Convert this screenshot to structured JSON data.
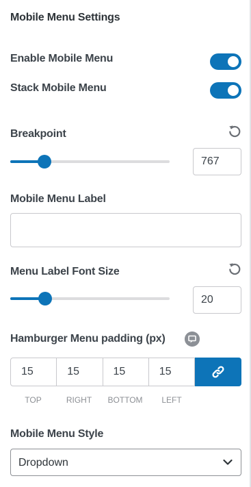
{
  "section_title": "Mobile Menu Settings",
  "enable_mobile_menu": {
    "label": "Enable Mobile Menu",
    "enabled": true
  },
  "stack_mobile_menu": {
    "label": "Stack Mobile Menu",
    "enabled": true
  },
  "breakpoint": {
    "label": "Breakpoint",
    "value": "767",
    "slider_fraction": 0.21
  },
  "mobile_menu_label": {
    "label": "Mobile Menu Label",
    "value": ""
  },
  "menu_label_font_size": {
    "label": "Menu Label Font Size",
    "value": "20",
    "slider_fraction": 0.22
  },
  "hamburger_padding": {
    "label": "Hamburger Menu padding (px)",
    "values": {
      "top": "15",
      "right": "15",
      "bottom": "15",
      "left": "15"
    },
    "captions": {
      "top": "TOP",
      "right": "RIGHT",
      "bottom": "BOTTOM",
      "left": "LEFT"
    }
  },
  "mobile_menu_style": {
    "label": "Mobile Menu Style",
    "selected": "Dropdown"
  },
  "icons": {
    "reset": "reset-icon",
    "info": "info-icon",
    "link": "link-icon",
    "chevron": "chevron-down-icon"
  },
  "colors": {
    "accent": "#0d74b8",
    "track": "#dcdcde",
    "text": "#3c434a"
  }
}
